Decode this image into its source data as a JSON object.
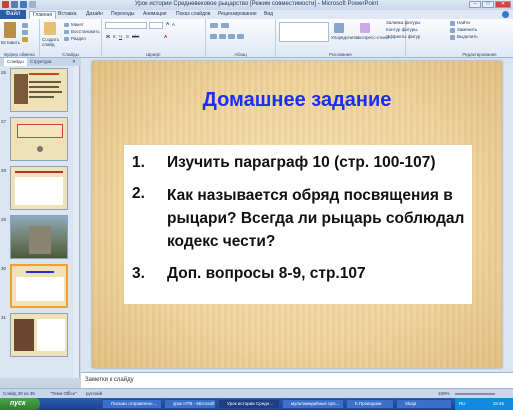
{
  "window": {
    "title": "Урок истории Средневековое рыцарство [Режим совместимости] - Microsoft PowerPoint"
  },
  "ribbon_tabs": [
    "Файл",
    "Главная",
    "Вставка",
    "Дизайн",
    "Переходы",
    "Анимация",
    "Показ слайдов",
    "Рецензирование",
    "Вид"
  ],
  "ribbon": {
    "paste": "Вставить",
    "new_slide": "Создать слайд",
    "layout": "Макет",
    "reset": "Восстановить",
    "section": "Раздел",
    "arrange": "Упорядочить",
    "quick_styles": "Экспресс-стили",
    "shape_fill": "Заливка фигуры",
    "shape_outline": "Контур фигуры",
    "shape_effects": "Эффекты фигур",
    "find": "Найти",
    "replace": "Заменить",
    "select": "Выделить",
    "groups": [
      "Буфер обмена",
      "Слайды",
      "Шрифт",
      "Абзац",
      "Рисование",
      "Редактирование"
    ]
  },
  "side_panel": {
    "tabs": [
      "Слайды",
      "Структура"
    ],
    "thumb_numbers": [
      "26",
      "27",
      "28",
      "29",
      "30",
      "31"
    ],
    "selected_index": 4
  },
  "slide": {
    "title": "Домашнее задание",
    "items": [
      {
        "num": "1.",
        "text": "Изучить параграф 10 (стр. 100-107)"
      },
      {
        "num": "2.",
        "text": "Как называется обряд посвящения в рыцари? Всегда ли рыцарь соблюдал кодекс чести?"
      },
      {
        "num": "3.",
        "text": "Доп. вопросы 8-9, стр.107"
      }
    ]
  },
  "notes": {
    "placeholder": "Заметки к слайду"
  },
  "status": {
    "slide": "Слайд 30 из 35",
    "theme": "\"Тема Office\"",
    "language": "русский",
    "zoom": "100%"
  },
  "taskbar": {
    "start": "пуск",
    "tasks": [
      "Письмо отправлено ...",
      "урок НТВ - Microsoft ...",
      "Урок истории Средн...",
      "мультимедийные про...",
      "К Проводник",
      "Skaja"
    ],
    "lang": "RU",
    "time": "18:46"
  }
}
